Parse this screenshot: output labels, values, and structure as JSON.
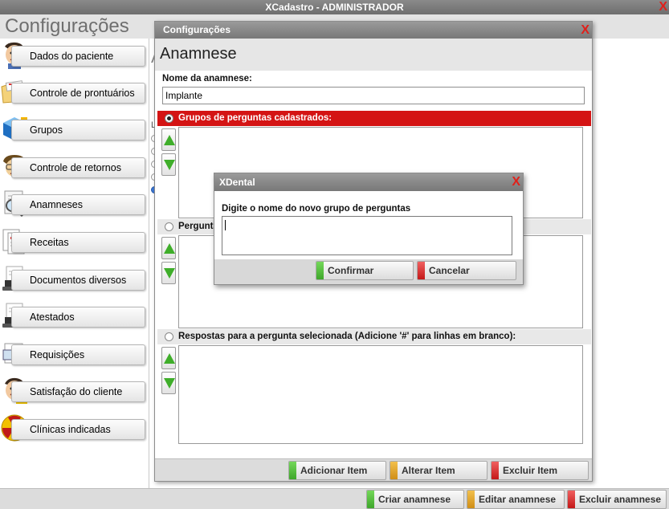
{
  "app": {
    "window_title": "XCadastro - ADMINISTRADOR",
    "close_glyph": "X",
    "page_title": "Configurações"
  },
  "sidebar": {
    "items": [
      {
        "label": "Dados do paciente",
        "icon": "patient-face-icon"
      },
      {
        "label": "Controle de prontuários",
        "icon": "folder-records-icon"
      },
      {
        "label": "Grupos",
        "icon": "blue-cube-icon"
      },
      {
        "label": "Controle de retornos",
        "icon": "returns-face-icon"
      },
      {
        "label": "Anamneses",
        "icon": "magnifier-document-icon"
      },
      {
        "label": "Receitas",
        "icon": "prescription-icon"
      },
      {
        "label": "Documentos diversos",
        "icon": "stamp-document-icon"
      },
      {
        "label": "Atestados",
        "icon": "stamp-certificate-icon"
      },
      {
        "label": "Requisições",
        "icon": "requisition-icon"
      },
      {
        "label": "Satisfação do cliente",
        "icon": "customer-face-icon"
      },
      {
        "label": "Clínicas indicadas",
        "icon": "radiation-icon"
      }
    ]
  },
  "behind": {
    "letter_a": "A",
    "letter_l": "L"
  },
  "config_dialog": {
    "title": "Configurações",
    "close_glyph": "X",
    "heading": "Anamnese",
    "name_label": "Nome da anamnese:",
    "name_value": "Implante",
    "groups_label": "Grupos de perguntas cadastrados:",
    "questions_label": "Perguntas",
    "answers_label": "Respostas para a pergunta selecionada (Adicione '#' para linhas em branco):",
    "buttons": {
      "add": "Adicionar Item",
      "edit": "Alterar Item",
      "delete": "Excluir Item"
    }
  },
  "xdental_dialog": {
    "title": "XDental",
    "close_glyph": "X",
    "prompt": "Digite o nome do novo grupo de perguntas",
    "input_value": "",
    "confirm": "Confirmar",
    "cancel": "Cancelar"
  },
  "bottom_bar": {
    "create": "Criar anamnese",
    "edit": "Editar anamnese",
    "delete": "Excluir anamnese"
  },
  "colors": {
    "accent_red": "#d41414",
    "confirm_green": "#3ea62a",
    "edit_orange": "#d08e16",
    "delete_red": "#c41818"
  }
}
